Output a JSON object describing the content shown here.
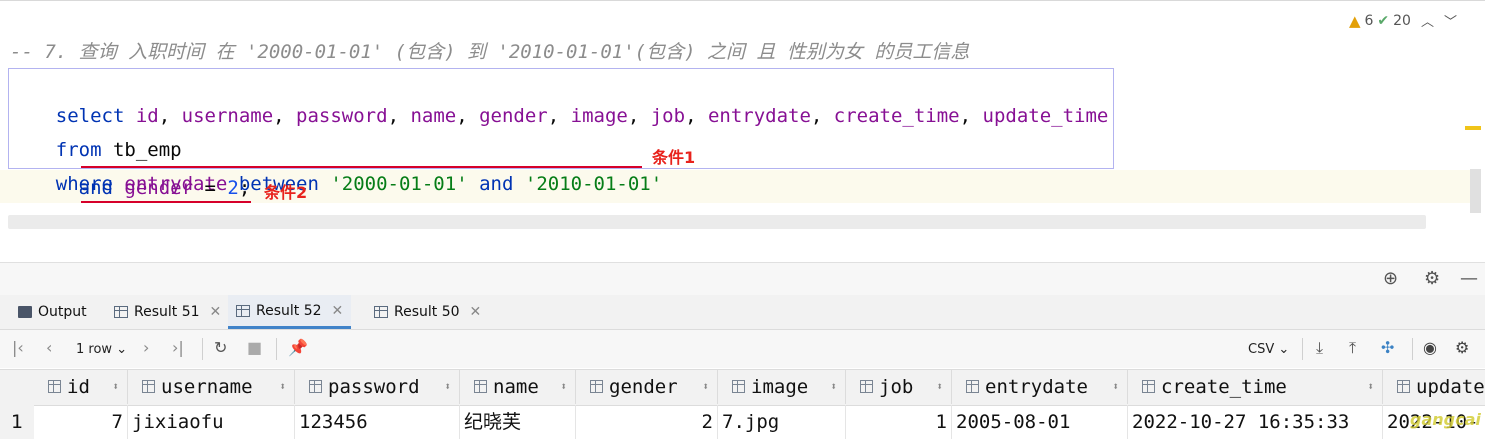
{
  "editor": {
    "warnings_count": "6",
    "weak_warnings_count": "20",
    "comment": "-- 7. 查询 入职时间 在 '2000-01-01' (包含) 到 '2010-01-01'(包含) 之间 且 性别为女 的员工信息",
    "line1": {
      "kw": "select",
      "cols": [
        "id",
        "username",
        "password",
        "name",
        "gender",
        "image",
        "job",
        "entrydate",
        "create_time",
        "update_time"
      ]
    },
    "line2": {
      "kw": "from",
      "table": "tb_emp"
    },
    "line3": {
      "kw": "where",
      "col": "entrydate",
      "kw2": "between",
      "v1": "'2000-01-01'",
      "kw3": "and",
      "v2": "'2010-01-01'"
    },
    "line4": {
      "kw": "and",
      "col": "gender",
      "op": "=",
      "num": "2",
      "semi": ";"
    },
    "annotation1": "条件1",
    "annotation2": "条件2"
  },
  "tabs": [
    {
      "label": "Output",
      "active": false,
      "closable": false
    },
    {
      "label": "Result 51",
      "active": false,
      "closable": true
    },
    {
      "label": "Result 52",
      "active": true,
      "closable": true
    },
    {
      "label": "Result 50",
      "active": false,
      "closable": true
    }
  ],
  "results_toolbar": {
    "rows_label": "1 row",
    "export_format": "CSV"
  },
  "table": {
    "columns": [
      "id",
      "username",
      "password",
      "name",
      "gender",
      "image",
      "job",
      "entrydate",
      "create_time",
      "update"
    ],
    "rows": [
      {
        "num": "1",
        "cells": [
          "7",
          "jixiaofu",
          "123456",
          "纪晓芙",
          "2",
          "7.jpg",
          "1",
          "2005-08-01",
          "2022-10-27 16:35:33",
          "2022-10-"
        ]
      }
    ]
  },
  "watermark": "gangcai",
  "colors": {
    "keyword": "#0033b3",
    "column": "#871094",
    "string": "#067d17",
    "number": "#1750eb",
    "annotation": "#e8221c",
    "active_tab": "#4083c9"
  }
}
